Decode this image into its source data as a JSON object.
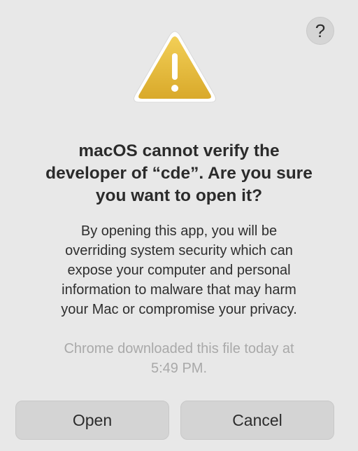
{
  "dialog": {
    "help_label": "?",
    "icon": "warning-triangle-icon",
    "title": "macOS cannot verify the\ndeveloper of “cde”. Are you sure\nyou want to open it?",
    "message": "By opening this app, you will be\noverriding system security which can\nexpose your computer and personal\ninformation to malware that may harm\nyour Mac or compromise your privacy.",
    "note": "Chrome downloaded this file today at\n5:49 PM.",
    "buttons": {
      "open": "Open",
      "cancel": "Cancel"
    }
  },
  "colors": {
    "background": "#e8e8e8",
    "button": "#d4d4d4",
    "warning_fill": "#e4b83a",
    "warning_border": "#ffffff",
    "note_text": "#a9a9a9"
  }
}
